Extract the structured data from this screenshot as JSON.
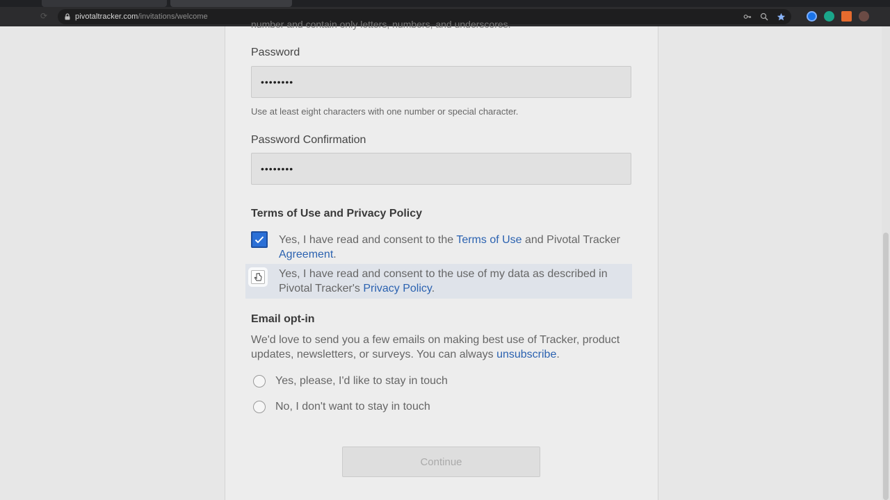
{
  "browser": {
    "url_host": "pivotaltracker.com",
    "url_path": "/invitations/welcome"
  },
  "form": {
    "clipped_hint": "number and contain only letters, numbers, and underscores.",
    "password": {
      "label": "Password",
      "value": "••••••••",
      "hint": "Use at least eight characters with one number or special character."
    },
    "password_confirmation": {
      "label": "Password Confirmation",
      "value": "••••••••"
    },
    "terms": {
      "title": "Terms of Use and Privacy Policy",
      "consent1": {
        "prefix": "Yes, I have read and consent to the ",
        "link1": "Terms of Use",
        "middle": " and Pivotal Tracker ",
        "link2": "Agreement",
        "suffix": ".",
        "checked": true
      },
      "consent2": {
        "prefix": "Yes, I have read and consent to the use of my data as described in Pivotal Tracker's ",
        "link": "Privacy Policy",
        "suffix": ".",
        "checked": false
      }
    },
    "email_optin": {
      "title": "Email opt-in",
      "text_prefix": "We'd love to send you a few emails on making best use of Tracker, product updates, newsletters, or surveys. You can always ",
      "link": "unsubscribe",
      "text_suffix": ".",
      "option_yes": "Yes, please, I'd like to stay in touch",
      "option_no": "No, I don't want to stay in touch"
    },
    "continue_label": "Continue"
  },
  "colors": {
    "checkbox_checked": "#2a6fd6",
    "link": "#2b62b0",
    "highlight_row": "#dfe3ea"
  }
}
